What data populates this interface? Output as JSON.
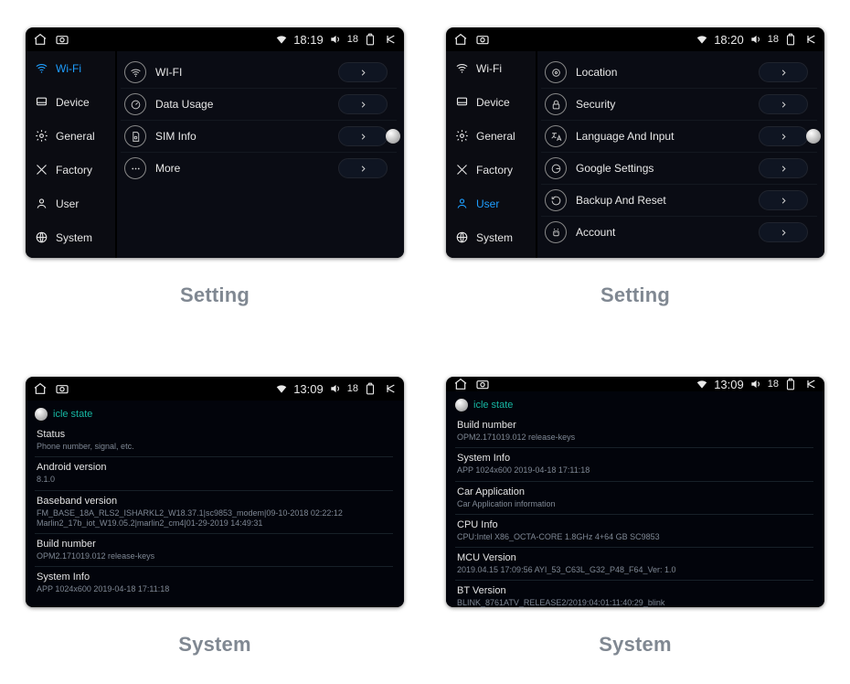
{
  "captions": [
    "Setting",
    "Setting",
    "System",
    "System"
  ],
  "sidebar": {
    "items": [
      {
        "label": "Wi-Fi",
        "icon": "wifi"
      },
      {
        "label": "Device",
        "icon": "device"
      },
      {
        "label": "General",
        "icon": "gear"
      },
      {
        "label": "Factory",
        "icon": "tools"
      },
      {
        "label": "User",
        "icon": "user"
      },
      {
        "label": "System",
        "icon": "globe"
      }
    ]
  },
  "devices": [
    {
      "type": "settings",
      "statusbar": {
        "time": "18:19",
        "volume": "18"
      },
      "active_index": 0,
      "rows": [
        {
          "label": "WI-FI",
          "icon": "wifi"
        },
        {
          "label": "Data Usage",
          "icon": "gauge"
        },
        {
          "label": "SIM Info",
          "icon": "sim"
        },
        {
          "label": "More",
          "icon": "dots"
        }
      ],
      "side_dot_row_index": 2
    },
    {
      "type": "settings",
      "statusbar": {
        "time": "18:20",
        "volume": "18"
      },
      "active_index": 4,
      "rows": [
        {
          "label": "Location",
          "icon": "location"
        },
        {
          "label": "Security",
          "icon": "lock"
        },
        {
          "label": "Language And Input",
          "icon": "language"
        },
        {
          "label": "Google Settings",
          "icon": "google"
        },
        {
          "label": "Backup And Reset",
          "icon": "backup"
        },
        {
          "label": "Account",
          "icon": "android"
        }
      ],
      "side_dot_row_index": 2
    },
    {
      "type": "system",
      "statusbar": {
        "time": "13:09",
        "volume": "18"
      },
      "header": "icle state",
      "items": [
        {
          "k": "Status",
          "v": "Phone number, signal, etc."
        },
        {
          "k": "Android version",
          "v": "8.1.0"
        },
        {
          "k": "Baseband version",
          "v": "FM_BASE_18A_RLS2_ISHARKL2_W18.37.1|sc9853_modem|09-10-2018 02:22:12\nMarlin2_17b_iot_W19.05.2|marlin2_cm4|01-29-2019 14:49:31"
        },
        {
          "k": "Build number",
          "v": "OPM2.171019.012 release-keys"
        },
        {
          "k": "System Info",
          "v": "APP 1024x600 2019-04-18 17:11:18"
        }
      ]
    },
    {
      "type": "system",
      "statusbar": {
        "time": "13:09",
        "volume": "18"
      },
      "header": "icle state",
      "items": [
        {
          "k": "Build number",
          "v": "OPM2.171019.012 release-keys"
        },
        {
          "k": "System Info",
          "v": "APP 1024x600 2019-04-18 17:11:18"
        },
        {
          "k": "Car Application",
          "v": "Car Application information"
        },
        {
          "k": "CPU Info",
          "v": "CPU:Intel X86_OCTA-CORE 1.8GHz 4+64 GB SC9853"
        },
        {
          "k": "MCU Version",
          "v": "2019.04.15 17:09:56 AYI_53_C63L_G32_P48_F64_Ver: 1.0"
        },
        {
          "k": "BT Version",
          "v": "BLINK_8761ATV_RELEASE2/2019:04:01:11:40:29_blink"
        }
      ]
    }
  ]
}
